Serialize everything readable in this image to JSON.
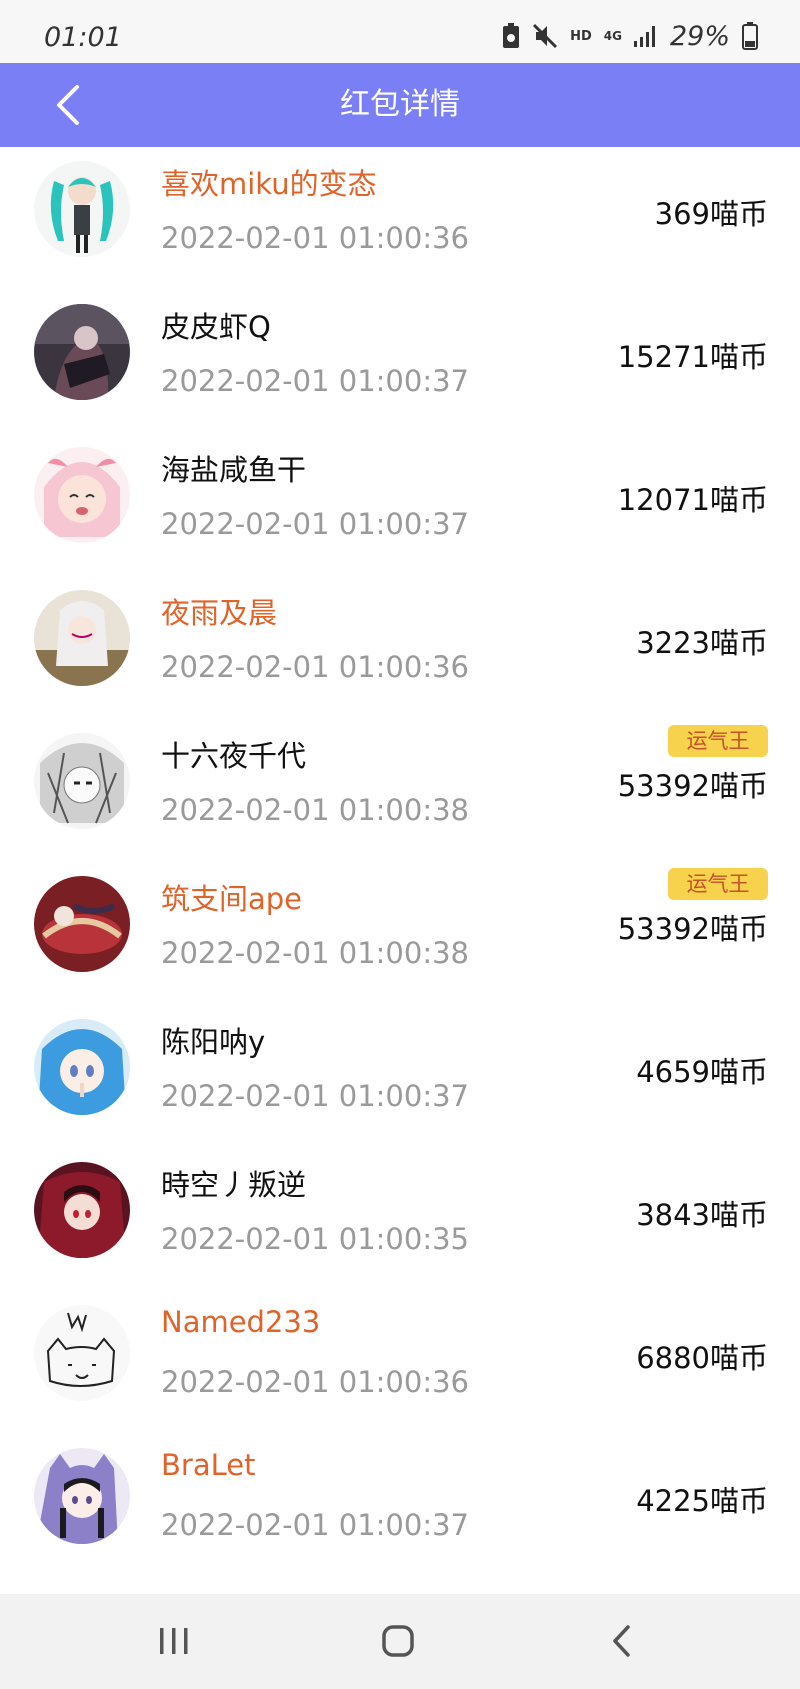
{
  "status_bar": {
    "time": "01:01",
    "network": "HD",
    "signal": "4G",
    "battery": "29%"
  },
  "header": {
    "title": "红包详情",
    "back_icon": "chevron-left-icon"
  },
  "colors": {
    "header_bg": "#7b7ff5",
    "name_highlight": "#e0642a",
    "name_normal": "#111111",
    "time": "#9a9a9a",
    "badge_bg": "#f7d24d",
    "badge_text": "#c7512a"
  },
  "records": [
    {
      "name": "喜欢miku的变态",
      "name_highlighted": true,
      "time": "2022-02-01 01:00:36",
      "amount": "369喵币",
      "badge": ""
    },
    {
      "name": "皮皮虾Q",
      "name_highlighted": false,
      "time": "2022-02-01 01:00:37",
      "amount": "15271喵币",
      "badge": ""
    },
    {
      "name": "海盐咸鱼干",
      "name_highlighted": false,
      "time": "2022-02-01 01:00:37",
      "amount": "12071喵币",
      "badge": ""
    },
    {
      "name": "夜雨及晨",
      "name_highlighted": true,
      "time": "2022-02-01 01:00:36",
      "amount": "3223喵币",
      "badge": ""
    },
    {
      "name": "十六夜千代",
      "name_highlighted": false,
      "time": "2022-02-01 01:00:38",
      "amount": "53392喵币",
      "badge": "运气王"
    },
    {
      "name": "筑支间ape",
      "name_highlighted": true,
      "time": "2022-02-01 01:00:38",
      "amount": "53392喵币",
      "badge": "运气王"
    },
    {
      "name": "陈阳呐y",
      "name_highlighted": false,
      "time": "2022-02-01 01:00:37",
      "amount": "4659喵币",
      "badge": ""
    },
    {
      "name": "時空丿叛逆",
      "name_highlighted": false,
      "time": "2022-02-01 01:00:35",
      "amount": "3843喵币",
      "badge": ""
    },
    {
      "name": "Named233",
      "name_highlighted": true,
      "time": "2022-02-01 01:00:36",
      "amount": "6880喵币",
      "badge": ""
    },
    {
      "name": "BraLet",
      "name_highlighted": true,
      "time": "2022-02-01 01:00:37",
      "amount": "4225喵币",
      "badge": ""
    }
  ],
  "nav_bar": {
    "recent_icon": "recent-apps-icon",
    "home_icon": "home-icon",
    "back_icon": "back-icon"
  }
}
